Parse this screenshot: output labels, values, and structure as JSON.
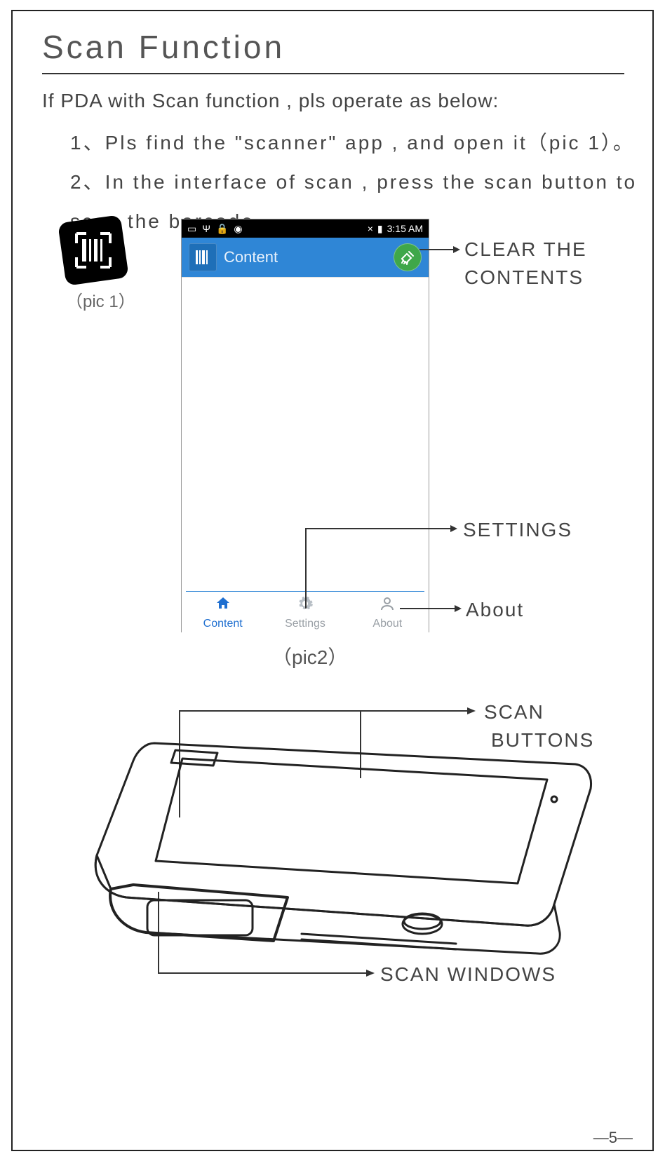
{
  "doc": {
    "title": "Scan  Function",
    "intro": "If PDA with Scan function , pls operate as below:",
    "step1": "1、Pls  find  the  \"scanner\"  app  , and  open  it（pic 1）。",
    "step2a": "2、In  the  interface  of  scan  ,   press  the  scan  button  to",
    "step2b": "scan  the  barcode。",
    "pic1_label": "（pic 1）",
    "pic2_label": "（pic2）",
    "page_number": "—5—"
  },
  "phone": {
    "status_time": "3:15 AM",
    "status_x": "×",
    "app_title": "Content",
    "tabs": {
      "content": "Content",
      "settings": "Settings",
      "about": "About"
    }
  },
  "callouts": {
    "clear_line1": "CLEAR THE",
    "clear_line2": "CONTENTS",
    "settings": "SETTINGS",
    "about": "About",
    "scan_buttons_line1": "SCAN",
    "scan_buttons_line2": "BUTTONS",
    "scan_windows": "SCAN  WINDOWS"
  }
}
